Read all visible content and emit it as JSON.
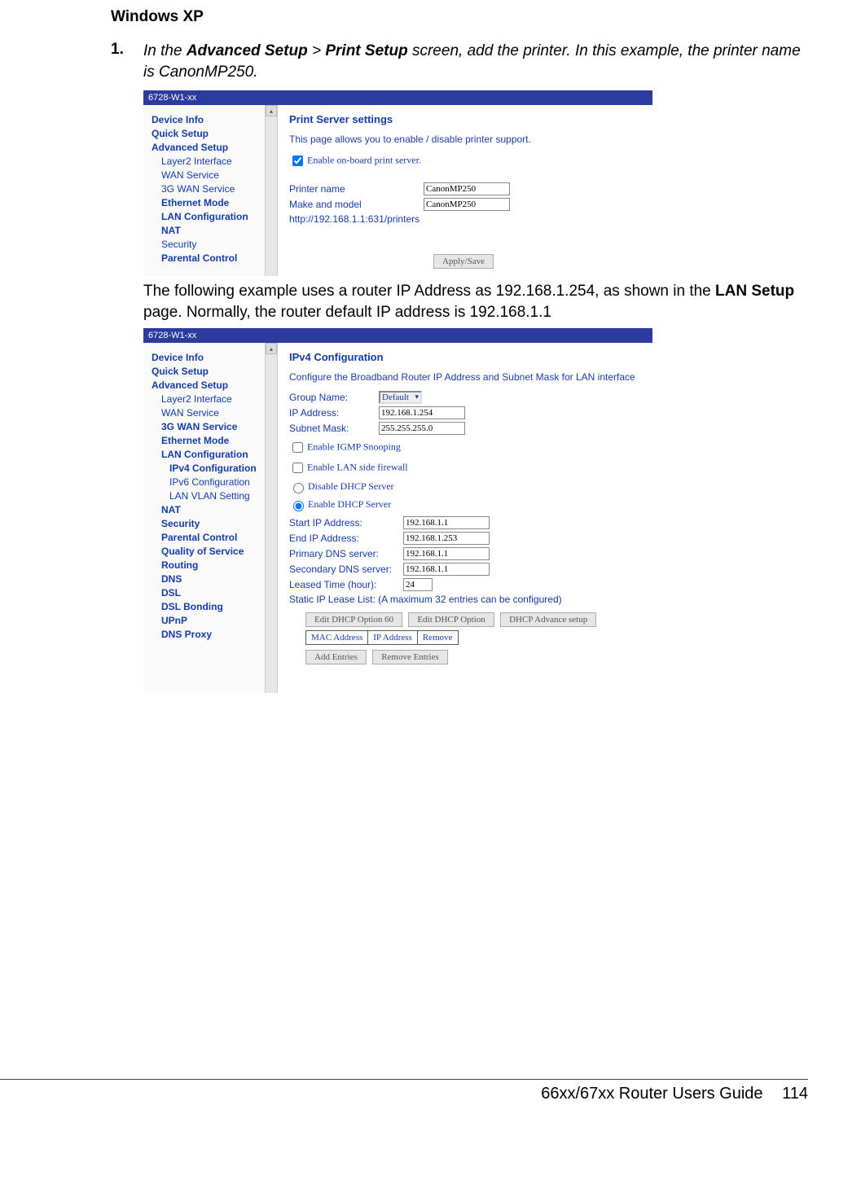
{
  "page": {
    "heading": "Windows XP",
    "step_num": "1.",
    "step_text": "In the ",
    "step_b1": "Advanced Setup",
    "step_gt": " > ",
    "step_b2": "Print Setup",
    "step_tail": " screen, add the printer. In this example, the printer name is CanonMP250.",
    "para_a": "The following example uses a router IP Address as 192.168.1.254, as shown in the ",
    "para_b": "LAN Setup",
    "para_c": " page.  Normally, the router default IP address is 192.168.1.1",
    "footer_text": "66xx/67xx Router Users Guide",
    "page_num": "114"
  },
  "shot1": {
    "title": "6728-W1-xx",
    "nav": {
      "i0": "Device Info",
      "i1": "Quick Setup",
      "i2": "Advanced Setup",
      "s0": "Layer2 Interface",
      "s1": "WAN Service",
      "s2": "3G WAN Service",
      "s3": "Ethernet Mode",
      "s4": "LAN Configuration",
      "s5": "NAT",
      "s6": "Security",
      "s7": "Parental Control"
    },
    "c": {
      "title": "Print Server settings",
      "desc": "This page allows you to enable / disable printer support.",
      "cb": "Enable on-board print server.",
      "l_name": "Printer name",
      "v_name": "CanonMP250",
      "l_mm": "Make and model",
      "v_mm": "CanonMP250",
      "url": "http://192.168.1.1:631/printers",
      "btn": "Apply/Save"
    }
  },
  "shot2": {
    "title": "6728-W1-xx",
    "nav": {
      "i0": "Device Info",
      "i1": "Quick Setup",
      "i2": "Advanced Setup",
      "s0": "Layer2 Interface",
      "s1": "WAN Service",
      "s2": "3G WAN Service",
      "s3": "Ethernet Mode",
      "s4": "LAN Configuration",
      "ss0": "IPv4 Configuration",
      "ss1": "IPv6 Configuration",
      "ss2": "LAN VLAN Setting",
      "s5": "NAT",
      "s6": "Security",
      "s7": "Parental Control",
      "s8": "Quality of Service",
      "s9": "Routing",
      "s10": "DNS",
      "s11": "DSL",
      "s12": "DSL Bonding",
      "s13": "UPnP",
      "s14": "DNS Proxy"
    },
    "c": {
      "title": "IPv4 Configuration",
      "desc": "Configure the Broadband Router IP Address and Subnet Mask for LAN interface",
      "l_gn": "Group Name:",
      "v_gn": "Default",
      "l_ip": "IP Address:",
      "v_ip": "192.168.1.254",
      "l_sm": "Subnet Mask:",
      "v_sm": "255.255.255.0",
      "cb1": "Enable IGMP Snooping",
      "cb2": "Enable LAN side firewall",
      "rb1": "Disable DHCP Server",
      "rb2": "Enable DHCP Server",
      "l_sip": "Start IP Address:",
      "v_sip": "192.168.1.1",
      "l_eip": "End IP Address:",
      "v_eip": "192.168.1.253",
      "l_pdns": "Primary DNS server:",
      "v_pdns": "192.168.1.1",
      "l_sdns": "Secondary DNS server:",
      "v_sdns": "192.168.1.1",
      "l_lt": "Leased Time (hour):",
      "v_lt": "24",
      "list": "Static IP Lease List: (A maximum 32 entries can be configured)",
      "b1": "Edit DHCP Option 60",
      "b2": "Edit DHCP Option",
      "b3": "DHCP Advance setup",
      "th1": "MAC Address",
      "th2": "IP Address",
      "th3": "Remove",
      "b4": "Add Entries",
      "b5": "Remove Entries"
    }
  }
}
